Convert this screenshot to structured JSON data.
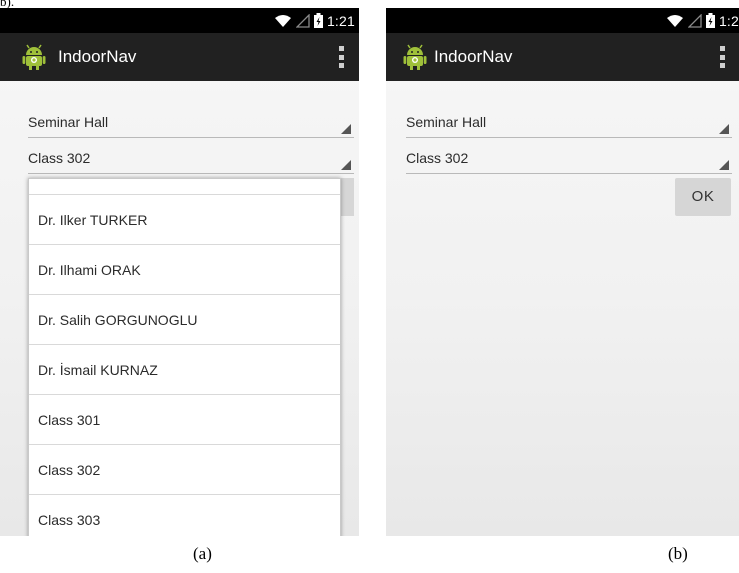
{
  "figure": {
    "header_fragment": "b).",
    "caption_a": "(a)",
    "caption_b": "(b)"
  },
  "screen_a": {
    "status_time": "1:21",
    "app_title": "IndoorNav",
    "spinner_from": "Seminar Hall",
    "spinner_to": "Class 302",
    "dropdown_items": [
      "Dr. Ilker TURKER",
      "Dr. Ilhami ORAK",
      "Dr. Salih GORGUNOGLU",
      "Dr. İsmail KURNAZ",
      "Class 301",
      "Class 302",
      "Class 303"
    ]
  },
  "screen_b": {
    "status_time": "1:24",
    "app_title": "IndoorNav",
    "spinner_from": "Seminar Hall",
    "spinner_to": "Class 302",
    "ok_label": "OK"
  },
  "icons": {
    "wifi": "wifi-icon",
    "signal": "signal-icon",
    "battery": "battery-icon",
    "app": "android-icon",
    "overflow": "overflow-menu-icon"
  },
  "colors": {
    "status_bar": "#000000",
    "action_bar": "#212121",
    "android_green": "#9fc03a"
  }
}
